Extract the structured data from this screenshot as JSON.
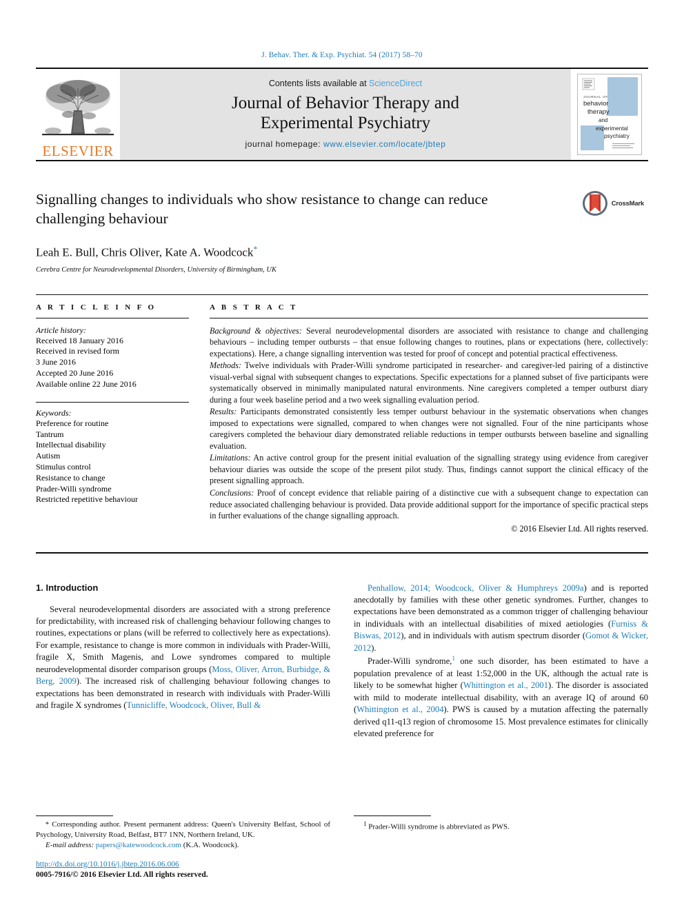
{
  "running_head": "J. Behav. Ther. & Exp. Psychiat. 54 (2017) 58–70",
  "masthead": {
    "publisher_name": "ELSEVIER",
    "contents_prefix": "Contents lists available at ",
    "sciencedirect": "ScienceDirect",
    "journal_title_line1": "Journal of Behavior Therapy and",
    "journal_title_line2": "Experimental Psychiatry",
    "homepage_label": "journal homepage: ",
    "homepage_url": "www.elsevier.com/locate/jbtep",
    "cover": {
      "kicker": "JOURNAL OF",
      "line1": "behavior",
      "line2": "therapy",
      "line3": "and",
      "line4": "experimental",
      "line5": "psychiatry"
    }
  },
  "article": {
    "title": "Signalling changes to individuals who show resistance to change can reduce challenging behaviour",
    "authors": "Leah E. Bull, Chris Oliver, Kate A. Woodcock",
    "corresponding_marker": "*",
    "affiliation": "Cerebra Centre for Neurodevelopmental Disorders, University of Birmingham, UK",
    "crossmark_label": "CrossMark"
  },
  "info": {
    "heading": "A R T I C L E   I N F O",
    "history_label": "Article history:",
    "history": [
      "Received 18 January 2016",
      "Received in revised form",
      "3 June 2016",
      "Accepted 20 June 2016",
      "Available online 22 June 2016"
    ],
    "keywords_label": "Keywords:",
    "keywords": [
      "Preference for routine",
      "Tantrum",
      "Intellectual disability",
      "Autism",
      "Stimulus control",
      "Resistance to change",
      "Prader-Willi syndrome",
      "Restricted repetitive behaviour"
    ]
  },
  "abstract": {
    "heading": "A B S T R A C T",
    "sections": [
      {
        "lead": "Background & objectives:",
        "body": " Several neurodevelopmental disorders are associated with resistance to change and challenging behaviours – including temper outbursts – that ensue following changes to routines, plans or expectations (here, collectively: expectations). Here, a change signalling intervention was tested for proof of concept and potential practical effectiveness."
      },
      {
        "lead": "Methods:",
        "body": " Twelve individuals with Prader-Willi syndrome participated in researcher- and caregiver-led pairing of a distinctive visual-verbal signal with subsequent changes to expectations. Specific expectations for a planned subset of five participants were systematically observed in minimally manipulated natural environments. Nine caregivers completed a temper outburst diary during a four week baseline period and a two week signalling evaluation period."
      },
      {
        "lead": "Results:",
        "body": " Participants demonstrated consistently less temper outburst behaviour in the systematic observations when changes imposed to expectations were signalled, compared to when changes were not signalled. Four of the nine participants whose caregivers completed the behaviour diary demonstrated reliable reductions in temper outbursts between baseline and signalling evaluation."
      },
      {
        "lead": "Limitations:",
        "body": " An active control group for the present initial evaluation of the signalling strategy using evidence from caregiver behaviour diaries was outside the scope of the present pilot study. Thus, findings cannot support the clinical efficacy of the present signalling approach."
      },
      {
        "lead": "Conclusions:",
        "body": " Proof of concept evidence that reliable pairing of a distinctive cue with a subsequent change to expectation can reduce associated challenging behaviour is provided. Data provide additional support for the importance of specific practical steps in further evaluations of the change signalling approach."
      }
    ],
    "copyright": "© 2016 Elsevier Ltd. All rights reserved."
  },
  "body": {
    "section_heading": "1. Introduction",
    "left_paragraph_html": "Several neurodevelopmental disorders are associated with a strong preference for predictability, with increased risk of challenging behaviour following changes to routines, expectations or plans (will be referred to collectively here as expectations). For example, resistance to change is more common in individuals with Prader-Willi, fragile X, Smith Magenis, and Lowe syndromes compared to multiple neurodevelopmental disorder comparison groups (<span class=\"cit\">Moss, Oliver, Arron, Burbidge, &amp; Berg, 2009</span>). The increased risk of challenging behaviour following changes to expectations has been demonstrated in research with individuals with Prader-Willi and fragile X syndromes (<span class=\"cit\">Tunnicliffe, Woodcock, Oliver, Bull &amp;</span>",
    "right_paragraph_1_html": "<span class=\"cit\">Penhallow, 2014; Woodcock, Oliver &amp; Humphreys 2009a</span>) and is reported anecdotally by families with these other genetic syndromes. Further, changes to expectations have been demonstrated as a common trigger of challenging behaviour in individuals with an intellectual disabilities of mixed aetiologies (<span class=\"cit\">Furniss &amp; Biswas, 2012</span>), and in individuals with autism spectrum disorder (<span class=\"cit\">Gomot &amp; Wicker, 2012</span>).",
    "right_paragraph_2_html": "Prader-Willi syndrome,<sup class=\"fn\">1</sup> one such disorder, has been estimated to have a population prevalence of at least 1:52,000 in the UK, although the actual rate is likely to be somewhat higher (<span class=\"cit\">Whittington et al., 2001</span>). The disorder is associated with mild to moderate intellectual disability, with an average IQ of around 60 (<span class=\"cit\">Whittington et al., 2004</span>). PWS is caused by a mutation affecting the paternally derived q11-q13 region of chromosome 15. Most prevalence estimates for clinically elevated preference for"
  },
  "footnotes": {
    "corresponding_html": "<span class=\"star\">*</span> Corresponding author. Present permanent address: Queen's University Belfast, School of Psychology, University Road, Belfast, BT7 1NN, Northern Ireland, UK.",
    "email_label": "E-mail address:",
    "email": "papers@katewoodcock.com",
    "email_suffix": "(K.A. Woodcock).",
    "doi": "http://dx.doi.org/10.1016/j.jbtep.2016.06.006",
    "issn_line": "0005-7916/© 2016 Elsevier Ltd. All rights reserved.",
    "right_note_html": "<sup class=\"fn\" style=\"color:#111\">1</sup> Prader-Willi syndrome is abbreviated as PWS."
  },
  "colors": {
    "link_blue": "#1f7bb6",
    "sciencedirect_blue": "#4ca3dd",
    "elsevier_orange": "#e87722",
    "masthead_gray": "#e3e3e3",
    "cover_blue": "#a8c6dd",
    "crossmark_red": "#c0392b"
  }
}
